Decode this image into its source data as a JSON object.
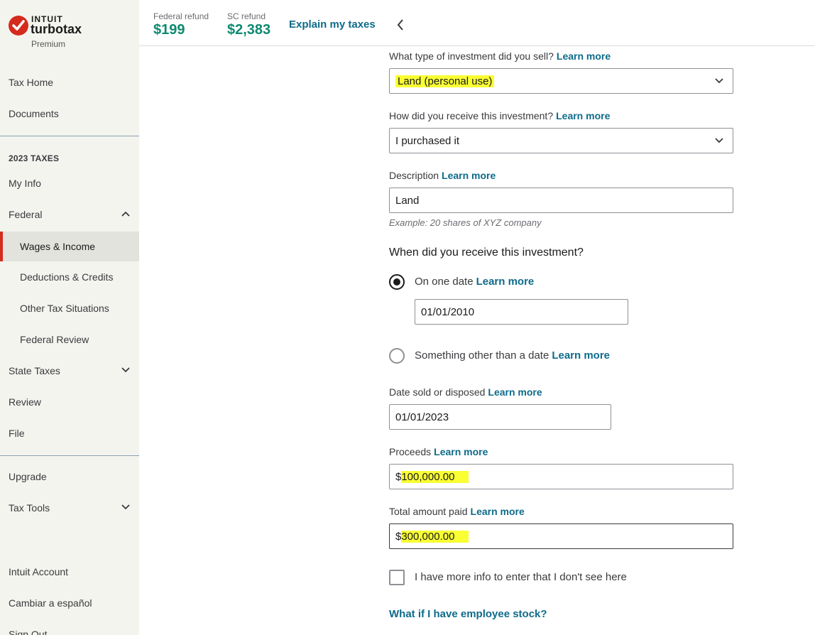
{
  "brand": {
    "company": "INTUIT",
    "product": "turbotax",
    "tier": "Premium"
  },
  "header": {
    "federal_label": "Federal refund",
    "federal_amount": "$199",
    "state_label": "SC refund",
    "state_amount": "$2,383",
    "explain": "Explain my taxes",
    "back_icon": "chevron-left-icon"
  },
  "sidebar": {
    "tax_home": "Tax Home",
    "documents": "Documents",
    "section_heading": "2023 TAXES",
    "my_info": "My Info",
    "federal": "Federal",
    "wages_income": "Wages & Income",
    "deductions_credits": "Deductions & Credits",
    "other_tax_situations": "Other Tax Situations",
    "federal_review": "Federal Review",
    "state_taxes": "State Taxes",
    "review": "Review",
    "file": "File",
    "upgrade": "Upgrade",
    "tax_tools": "Tax Tools",
    "intuit_account": "Intuit Account",
    "cambiar": "Cambiar a español",
    "sign_out": "Sign Out"
  },
  "form": {
    "learn_more": "Learn more",
    "investment_type_label": "What type of investment did you sell?",
    "investment_type_value": "Land (personal use)",
    "receive_how_label": "How did you receive this investment?",
    "receive_how_value": "I purchased it",
    "description_label": "Description",
    "description_value": "Land",
    "description_example": "Example: 20 shares of XYZ company",
    "when_question": "When did you receive this investment?",
    "one_date_label": "On one date",
    "one_date_value": "01/01/2010",
    "other_date_label": "Something other than a date",
    "date_sold_label": "Date sold or disposed",
    "date_sold_value": "01/01/2023",
    "proceeds_label": "Proceeds",
    "proceeds_currency": "$",
    "proceeds_value": "100,000.00",
    "paid_label": "Total amount paid",
    "paid_currency": "$",
    "paid_value": "300,000.00",
    "more_info_label": "I have more info to enter that I don't see here",
    "employee_stock_link": "What if I have employee stock?"
  },
  "colors": {
    "accent_red": "#d52b1e",
    "link": "#0d6b8a",
    "refund_green": "#0e8a6f",
    "highlight": "#f9ff33"
  }
}
